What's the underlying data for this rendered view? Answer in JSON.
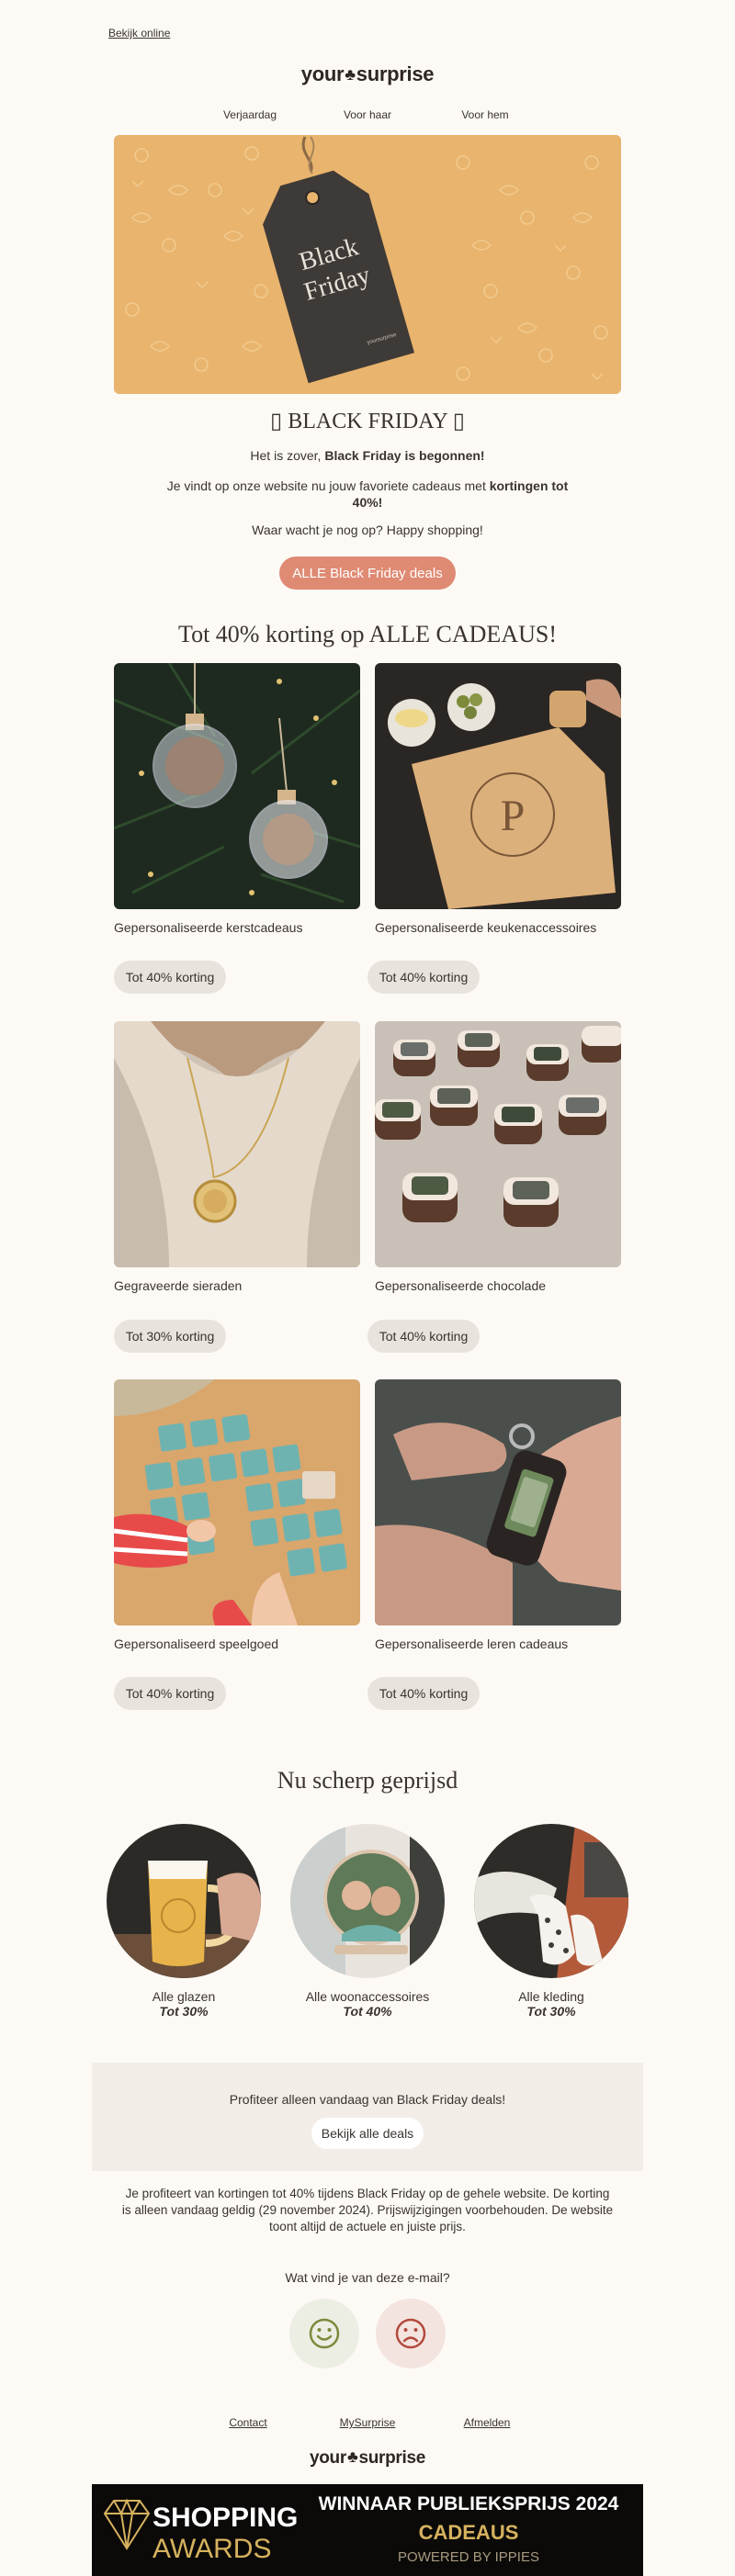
{
  "header": {
    "view_online": "Bekijk online",
    "logo_left": "your",
    "logo_right": "surprise"
  },
  "nav": [
    {
      "label": "Verjaardag"
    },
    {
      "label": "Voor haar"
    },
    {
      "label": "Voor hem"
    }
  ],
  "hero": {
    "tag_line1": "Black",
    "tag_line2": "Friday",
    "tag_small": "yoursurprise",
    "background_color": "#e9b46d"
  },
  "intro": {
    "title": "▯ BLACK FRIDAY ▯",
    "line1_prefix": "Het is zover, ",
    "line1_bold": "Black Friday is begonnen!",
    "line2_prefix": "Je vindt op onze website nu jouw favoriete cadeaus met ",
    "line2_bold": "kortingen tot 40%!",
    "line3": "Waar wacht je nog op? Happy shopping!",
    "cta": "ALLE Black Friday deals",
    "cta_color": "#df8a73"
  },
  "section1": {
    "title": "Tot 40% korting op ALLE CADEAUS!",
    "cards": [
      {
        "name": "Gepersonaliseerde kerstcadeaus",
        "discount": "Tot 40% korting"
      },
      {
        "name": "Gepersonaliseerde keukenaccessoires",
        "discount": "Tot 40% korting"
      },
      {
        "name": "Gegraveerde sieraden",
        "discount": "Tot 30% korting"
      },
      {
        "name": "Gepersonaliseerde chocolade",
        "discount": "Tot 40% korting"
      },
      {
        "name": "Gepersonaliseerd speelgoed",
        "discount": "Tot 40% korting"
      },
      {
        "name": "Gepersonaliseerde leren cadeaus",
        "discount": "Tot 40% korting"
      }
    ]
  },
  "section2": {
    "title": "Nu scherp geprijsd",
    "items": [
      {
        "label": "Alle glazen",
        "discount": "Tot 30%"
      },
      {
        "label": "Alle woonaccessoires",
        "discount": "Tot 40%"
      },
      {
        "label": "Alle kleding",
        "discount": "Tot 30%"
      }
    ]
  },
  "deal_box": {
    "text": "Profiteer alleen vandaag van Black Friday deals!",
    "button": "Bekijk alle deals"
  },
  "fine_print": "Je profiteert van kortingen tot 40% tijdens Black Friday op de gehele website. De korting is alleen vandaag geldig (29 november 2024). Prijswijzigingen voorbehouden. De website toont altijd de actuele en juiste prijs.",
  "feedback": {
    "question": "Wat vind je van deze e-mail?",
    "happy_icon": "smile-icon",
    "sad_icon": "frown-icon"
  },
  "footer": {
    "links": [
      {
        "label": "Contact"
      },
      {
        "label": "MySurprise"
      },
      {
        "label": "Afmelden"
      }
    ]
  },
  "award": {
    "left_line1": "SHOPPING",
    "left_line2": "AWARDS",
    "right_line1": "WINNAAR PUBLIEKSPRIJS 2024",
    "right_line2": "CADEAUS",
    "right_line3": "POWERED BY IPPIES",
    "gold": "#d6b25e"
  }
}
